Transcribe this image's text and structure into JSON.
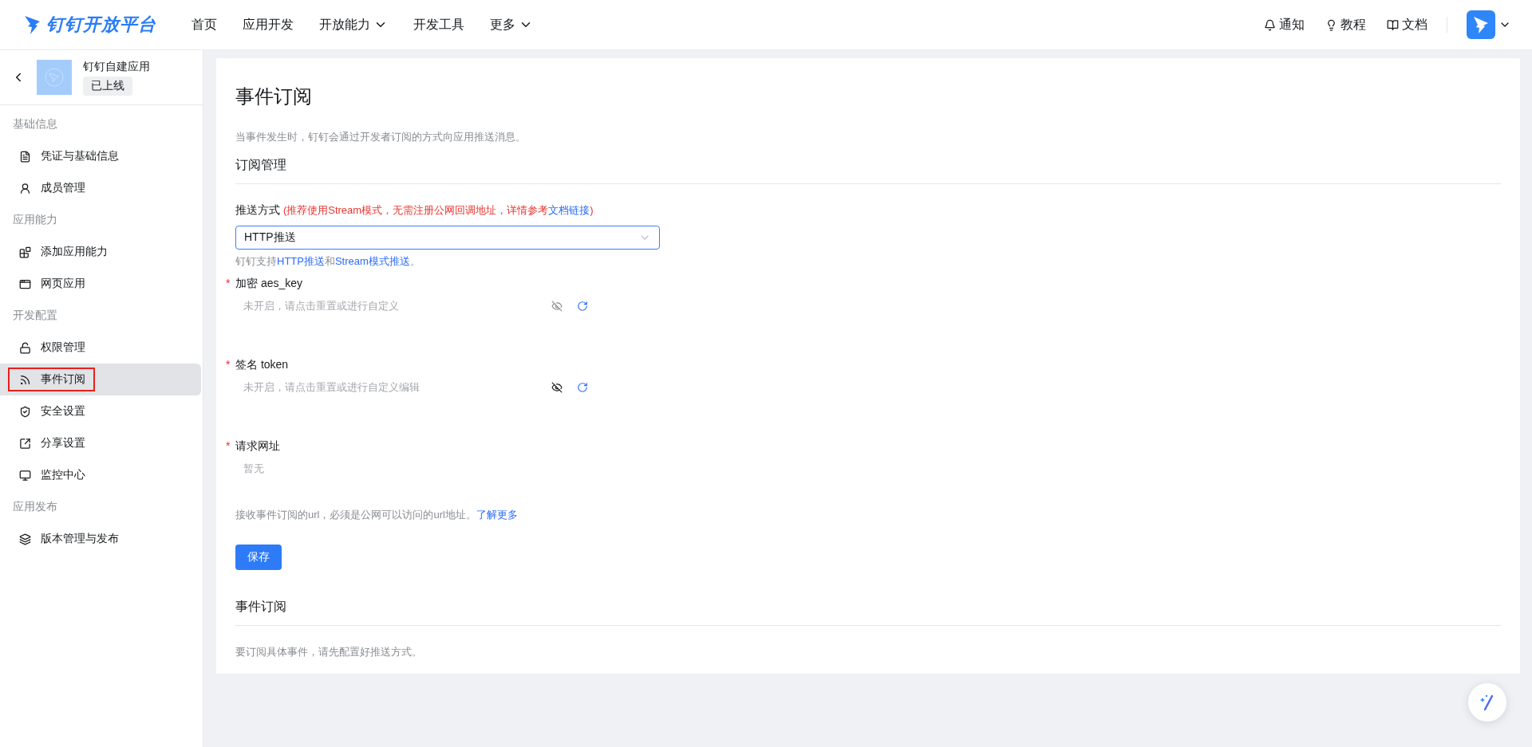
{
  "header": {
    "logo": "钉钉开放平台",
    "nav": [
      {
        "label": "首页",
        "has_dropdown": false
      },
      {
        "label": "应用开发",
        "has_dropdown": false
      },
      {
        "label": "开放能力",
        "has_dropdown": true
      },
      {
        "label": "开发工具",
        "has_dropdown": false
      },
      {
        "label": "更多",
        "has_dropdown": true
      }
    ],
    "links": [
      "通知",
      "教程",
      "文档"
    ]
  },
  "sidebar": {
    "app_name": "钉钉自建应用",
    "app_status": "已上线",
    "groups": [
      {
        "title": "基础信息",
        "items": [
          {
            "label": "凭证与基础信息",
            "selected": false,
            "outlined": false
          },
          {
            "label": "成员管理",
            "selected": false,
            "outlined": false
          }
        ]
      },
      {
        "title": "应用能力",
        "items": [
          {
            "label": "添加应用能力",
            "selected": false,
            "outlined": false
          },
          {
            "label": "网页应用",
            "selected": false,
            "outlined": false
          }
        ]
      },
      {
        "title": "开发配置",
        "items": [
          {
            "label": "权限管理",
            "selected": false,
            "outlined": false
          },
          {
            "label": "事件订阅",
            "selected": true,
            "outlined": true
          },
          {
            "label": "安全设置",
            "selected": false,
            "outlined": false
          },
          {
            "label": "分享设置",
            "selected": false,
            "outlined": false
          },
          {
            "label": "监控中心",
            "selected": false,
            "outlined": false
          }
        ]
      },
      {
        "title": "应用发布",
        "items": [
          {
            "label": "版本管理与发布",
            "selected": false,
            "outlined": false
          }
        ]
      }
    ]
  },
  "page": {
    "title": "事件订阅",
    "description": "当事件发生时，钉钉会通过开发者订阅的方式向应用推送消息。",
    "section_title": "订阅管理",
    "push_mode": {
      "label": "推送方式",
      "note": [
        {
          "kind": "text",
          "text": "(推荐使用Stream模式，无需注册公网回调地址，详情参考"
        },
        {
          "kind": "link",
          "text": "文档链接"
        },
        {
          "kind": "text",
          "text": ")"
        }
      ],
      "value": "HTTP推送",
      "help": [
        {
          "kind": "text",
          "text": "钉钉支持"
        },
        {
          "kind": "link",
          "text": "HTTP推送"
        },
        {
          "kind": "text",
          "text": "和"
        },
        {
          "kind": "link",
          "text": "Stream模式推送"
        },
        {
          "kind": "text",
          "text": "。"
        }
      ]
    },
    "fields": [
      {
        "kind": "secret",
        "label": "加密 aes_key",
        "required_mark": "*",
        "value": "未开启，请点击重置或进行自定义"
      },
      {
        "kind": "secret",
        "label": "签名 token",
        "required_mark": "*",
        "value": "未开启，请点击重置或进行自定义编辑"
      },
      {
        "kind": "plain",
        "label": "请求网址",
        "required_mark": "*",
        "value": "暂无"
      }
    ],
    "url_help": "接收事件订阅的url，必须是公网可以访问的url地址。",
    "url_help_link": "了解更多",
    "save_button": "保存",
    "events_title": "事件订阅",
    "events_text": "要订阅具体事件，请先配置好推送方式。"
  }
}
